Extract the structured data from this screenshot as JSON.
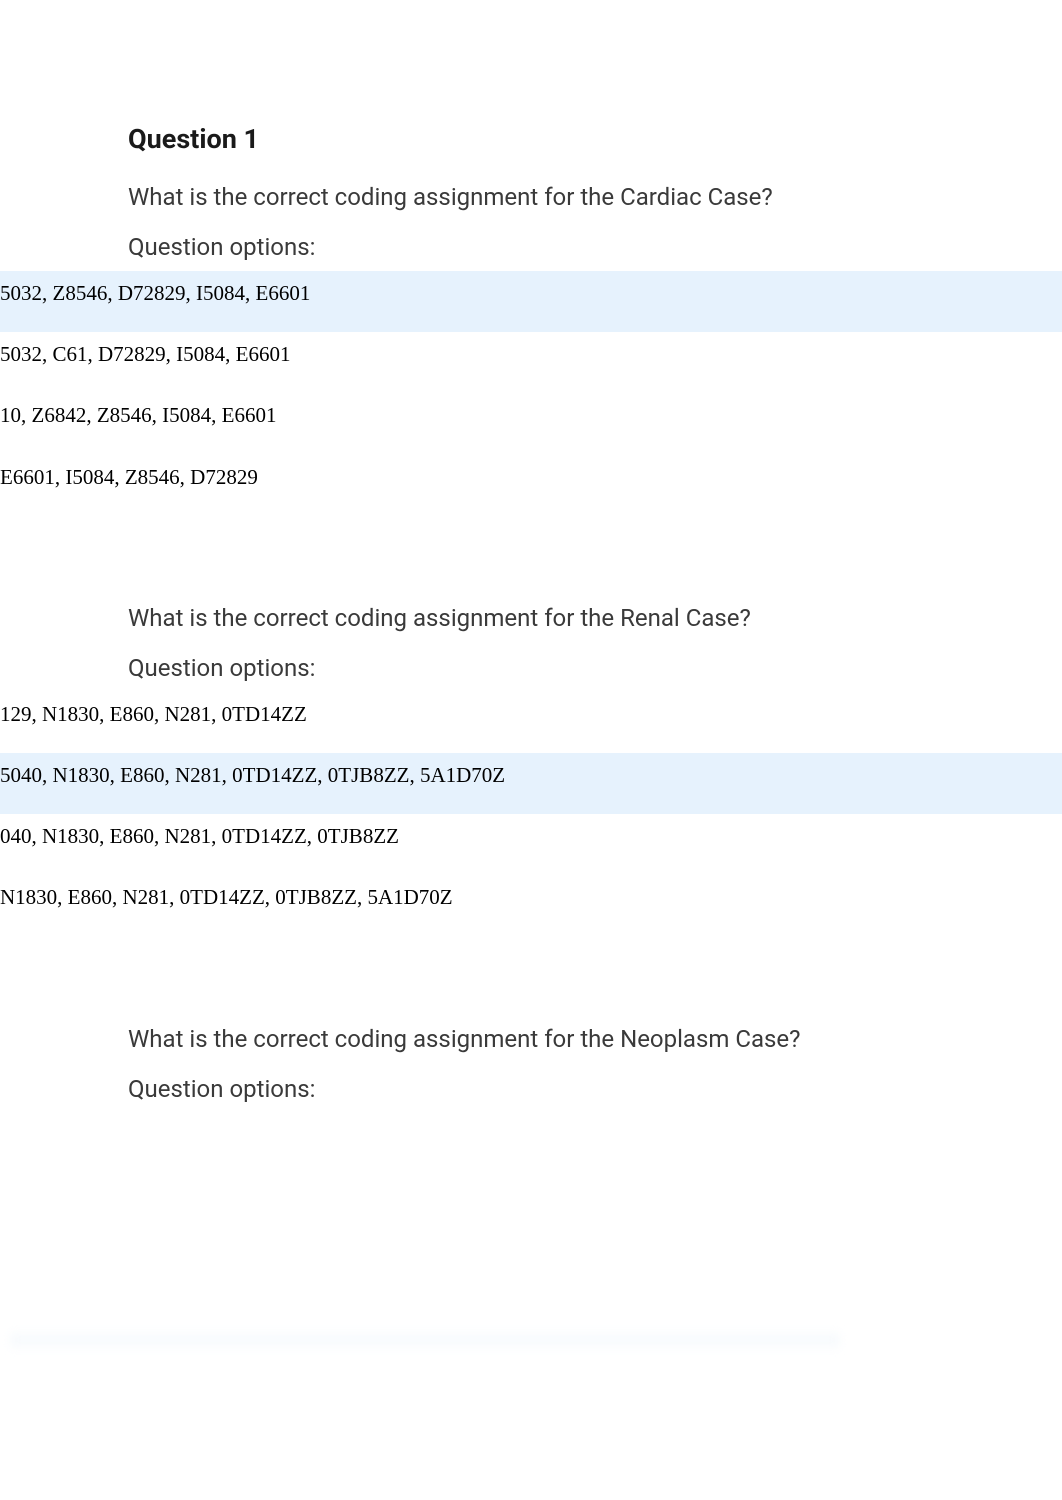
{
  "question_title": "Question 1",
  "sections": [
    {
      "prompt": "What is the correct coding assignment for the Cardiac Case?",
      "options_label": "Question options:",
      "options": [
        {
          "text": "5032, Z8546, D72829, I5084, E6601",
          "highlighted": true
        },
        {
          "text": "5032, C61, D72829, I5084, E6601",
          "highlighted": false
        },
        {
          "text": "10, Z6842, Z8546, I5084, E6601",
          "highlighted": false
        },
        {
          "text": "E6601, I5084, Z8546, D72829",
          "highlighted": false
        }
      ]
    },
    {
      "prompt": "What is the correct coding assignment for the Renal Case?",
      "options_label": "Question options:",
      "options": [
        {
          "text": "129, N1830, E860, N281, 0TD14ZZ",
          "highlighted": false
        },
        {
          "text": "5040, N1830, E860, N281, 0TD14ZZ, 0TJB8ZZ, 5A1D70Z",
          "highlighted": true
        },
        {
          "text": "040, N1830, E860, N281, 0TD14ZZ, 0TJB8ZZ",
          "highlighted": false
        },
        {
          "text": "N1830, E860, N281, 0TD14ZZ, 0TJB8ZZ, 5A1D70Z",
          "highlighted": false
        }
      ]
    },
    {
      "prompt": "What is the correct coding assignment for the Neoplasm Case?",
      "options_label": "Question options:",
      "options": []
    }
  ]
}
